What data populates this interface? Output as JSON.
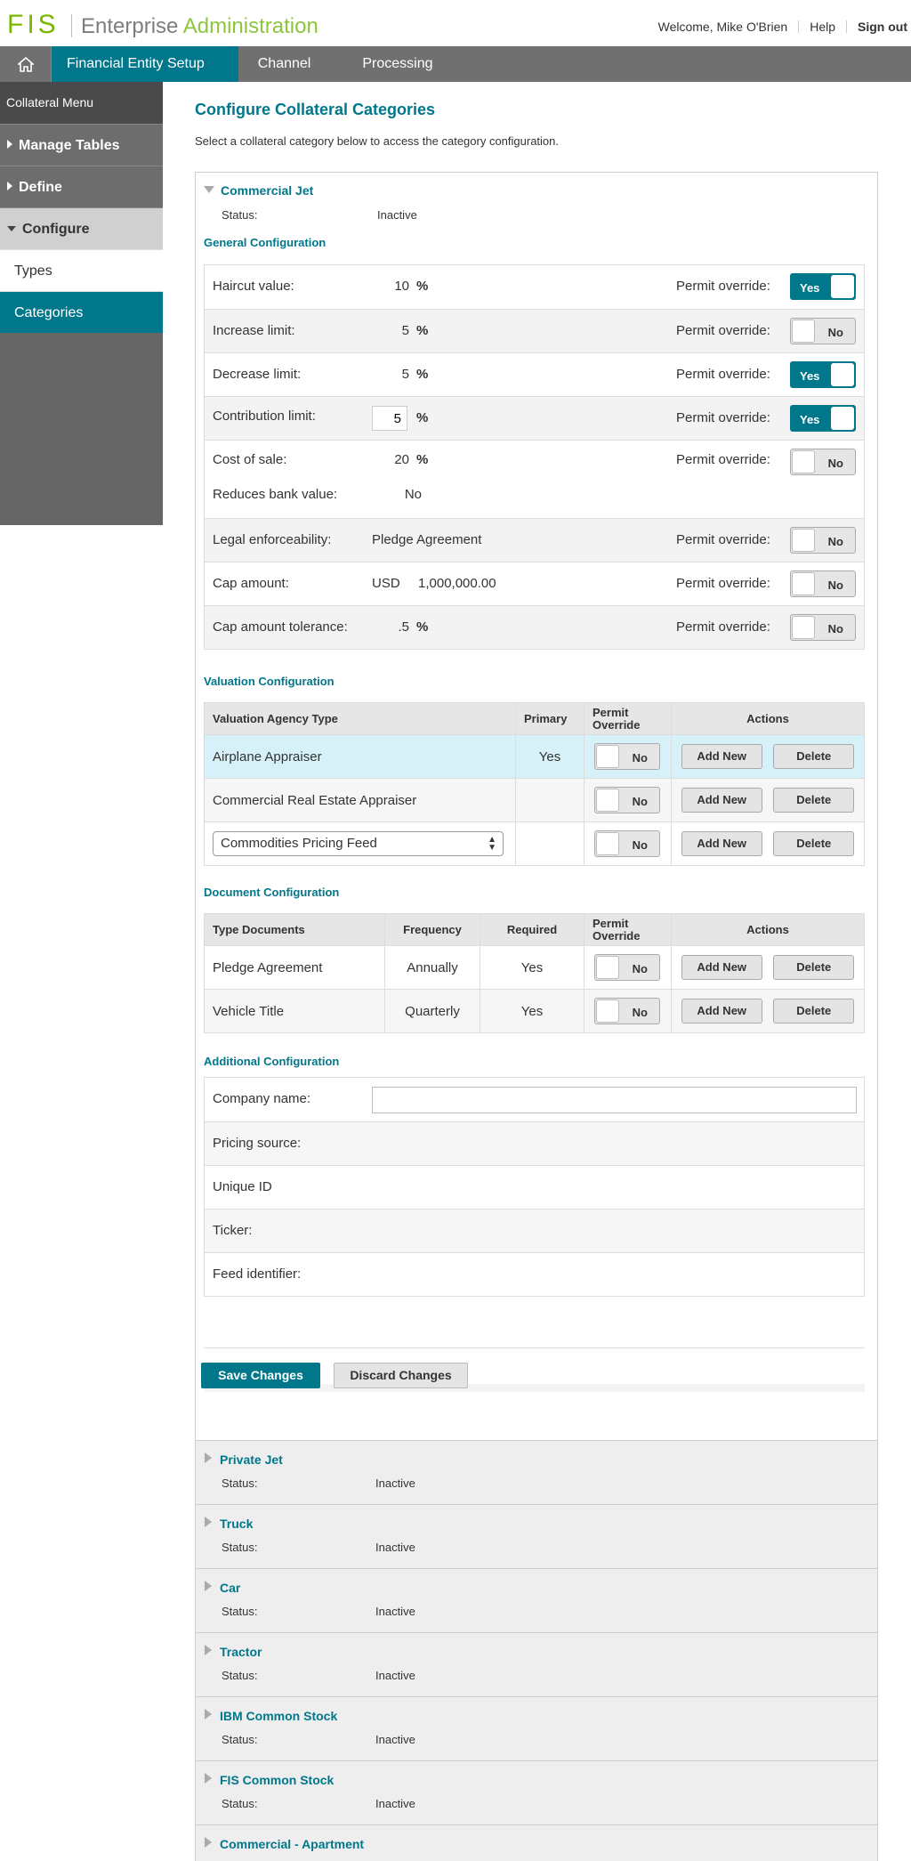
{
  "header": {
    "logo_text": "FIS",
    "app_title_part1": "Enterprise",
    "app_title_part2": "Administration",
    "welcome": "Welcome, Mike O'Brien",
    "help": "Help",
    "sign_out": "Sign out"
  },
  "nav": {
    "home_icon": "home-icon",
    "tabs": [
      "Financial Entity Setup",
      "Channel",
      "Processing"
    ],
    "active_tab": "Financial Entity Setup"
  },
  "sidebar": {
    "title": "Collateral Menu",
    "sections": [
      "Manage Tables",
      "Define",
      "Configure"
    ],
    "items": [
      "Types",
      "Categories"
    ],
    "active_item": "Categories"
  },
  "page": {
    "title": "Configure Collateral Categories",
    "description": "Select a collateral category below to access the category configuration."
  },
  "category": {
    "name": "Commercial Jet",
    "status_label": "Status:",
    "status_value": "Inactive"
  },
  "general": {
    "heading": "General Configuration",
    "permit_label": "Permit override:",
    "reduces_label": "Reduces bank value:",
    "reduces_value": "No",
    "rows": [
      {
        "label": "Haircut value:",
        "value": "10",
        "unit": "%",
        "toggle": "Yes"
      },
      {
        "label": "Increase limit:",
        "value": "5",
        "unit": "%",
        "toggle": "No"
      },
      {
        "label": "Decrease limit:",
        "value": "5",
        "unit": "%",
        "toggle": "Yes"
      },
      {
        "label": "Contribution limit:",
        "value": "5",
        "unit": "%",
        "toggle": "Yes"
      },
      {
        "label": "Cost of sale:",
        "value": "20",
        "unit": "%",
        "toggle": "No"
      },
      {
        "label": "Legal enforceability:",
        "value": "Pledge Agreement",
        "toggle": "No"
      },
      {
        "label": "Cap amount:",
        "currency": "USD",
        "value": "1,000,000.00",
        "toggle": "No"
      },
      {
        "label": "Cap amount tolerance:",
        "value": ".5",
        "unit": "%",
        "toggle": "No"
      }
    ]
  },
  "valuation": {
    "heading": "Valuation Configuration",
    "columns": [
      "Valuation Agency Type",
      "Primary",
      "Permit Override",
      "Actions"
    ],
    "rows": [
      {
        "type": "Airplane Appraiser",
        "primary": "Yes",
        "toggle": "No"
      },
      {
        "type": "Commercial Real Estate Appraiser",
        "primary": "",
        "toggle": "No"
      },
      {
        "type": "Commodities Pricing Feed",
        "primary": "",
        "toggle": "No"
      }
    ],
    "add_label": "Add New",
    "delete_label": "Delete"
  },
  "documents": {
    "heading": "Document Configuration",
    "columns": [
      "Type Documents",
      "Frequency",
      "Required",
      "Permit Override",
      "Actions"
    ],
    "rows": [
      {
        "type": "Pledge Agreement",
        "frequency": "Annually",
        "required": "Yes",
        "toggle": "No"
      },
      {
        "type": "Vehicle Title",
        "frequency": "Quarterly",
        "required": "Yes",
        "toggle": "No"
      }
    ]
  },
  "additional": {
    "heading": "Additional Configuration",
    "rows": [
      "Company name:",
      "Pricing source:",
      "Unique ID",
      "Ticker:",
      "Feed identifier:"
    ],
    "company_value": ""
  },
  "actions": {
    "save": "Save Changes",
    "discard": "Discard Changes"
  },
  "other_categories": [
    {
      "name": "Private Jet",
      "status": "Inactive"
    },
    {
      "name": "Truck",
      "status": "Inactive"
    },
    {
      "name": "Car",
      "status": "Inactive"
    },
    {
      "name": "Tractor",
      "status": "Inactive"
    },
    {
      "name": "IBM Common Stock",
      "status": "Inactive"
    },
    {
      "name": "FIS Common Stock",
      "status": "Inactive"
    },
    {
      "name": "Commercial - Apartment",
      "status": ""
    }
  ]
}
